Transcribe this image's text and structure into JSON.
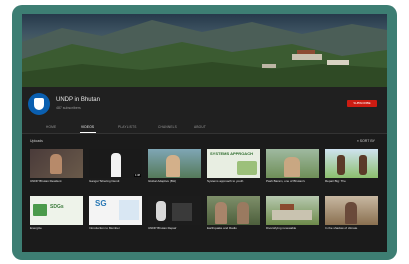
{
  "channel": {
    "name": "UNDP in Bhutan",
    "subscribers": "487 subscribers",
    "subscribe_label": "SUBSCRIBE"
  },
  "tabs": [
    {
      "label": "HOME"
    },
    {
      "label": "VIDEOS"
    },
    {
      "label": "PLAYLISTS"
    },
    {
      "label": "CHANNELS"
    },
    {
      "label": "ABOUT"
    }
  ],
  "section": {
    "title": "Uploads",
    "sort_label": "SORT BY"
  },
  "videos": [
    {
      "title": "UNDP Bhutan Resident",
      "meta": "",
      "duration": "",
      "thumb_text": ""
    },
    {
      "title": "Gangsi Tshering Dendi",
      "meta": "",
      "duration": "1:38",
      "thumb_text": ""
    },
    {
      "title": "Global Adaptive (BH)",
      "meta": "",
      "duration": "",
      "thumb_text": ""
    },
    {
      "title": "Systems approach to youth",
      "meta": "",
      "duration": "",
      "thumb_text": "SYSTEMS APPROACH"
    },
    {
      "title": "Pash Baram, one of Bhutan's",
      "meta": "",
      "duration": "",
      "thumb_text": ""
    },
    {
      "title": "Repair Big: The",
      "meta": "",
      "duration": "",
      "thumb_text": ""
    },
    {
      "title": "Energize",
      "meta": "",
      "duration": "",
      "thumb_text": "SDGs"
    },
    {
      "title": "Introduction to Member",
      "meta": "",
      "duration": "",
      "thumb_text": "SG"
    },
    {
      "title": "UNDP Bhutan Repair",
      "meta": "",
      "duration": "",
      "thumb_text": ""
    },
    {
      "title": "Earthquake and Radio",
      "meta": "",
      "duration": "",
      "thumb_text": ""
    },
    {
      "title": "Diversifying renewable",
      "meta": "",
      "duration": "",
      "thumb_text": ""
    },
    {
      "title": "In the shadow of climate",
      "meta": "",
      "duration": "",
      "thumb_text": ""
    }
  ],
  "colors": {
    "frame": "#3d7e73",
    "page_bg": "#1b1b1b",
    "subscribe": "#cc1c12"
  }
}
